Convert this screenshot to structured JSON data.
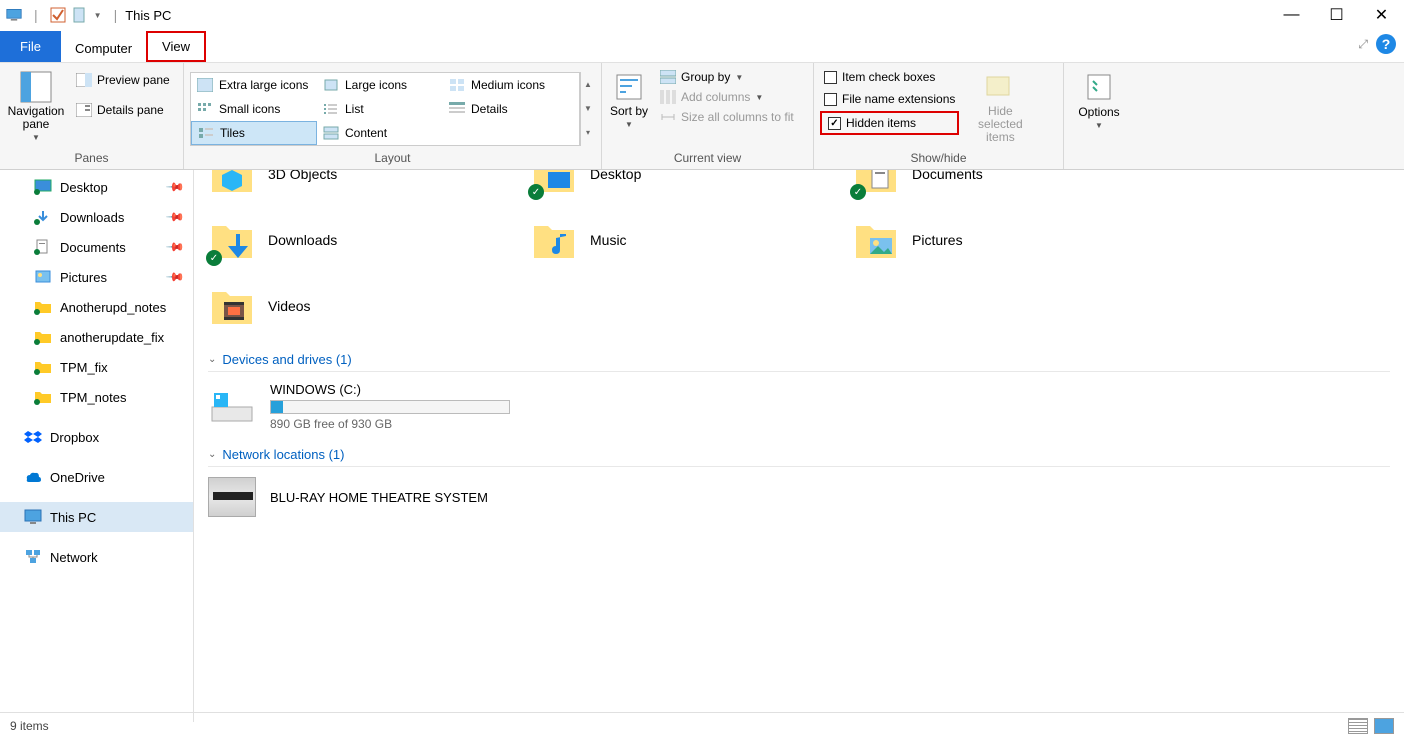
{
  "titlebar": {
    "title": "This PC"
  },
  "tabs": {
    "file": "File",
    "computer": "Computer",
    "view": "View"
  },
  "ribbon": {
    "panes": {
      "navigation": "Navigation pane",
      "preview": "Preview pane",
      "details_pane": "Details pane",
      "group_label": "Panes"
    },
    "layout": {
      "items": [
        "Extra large icons",
        "Large icons",
        "Medium icons",
        "Small icons",
        "List",
        "Details",
        "Tiles",
        "Content"
      ],
      "selected": "Tiles",
      "group_label": "Layout"
    },
    "current_view": {
      "sort_by": "Sort by",
      "group_by": "Group by",
      "add_columns": "Add columns",
      "size_all": "Size all columns to fit",
      "group_label": "Current view"
    },
    "show_hide": {
      "item_check_boxes": "Item check boxes",
      "file_name_ext": "File name extensions",
      "hidden_items": "Hidden items",
      "hide_selected": "Hide selected items",
      "group_label": "Show/hide"
    },
    "options": {
      "label": "Options"
    }
  },
  "sidebar": {
    "items": [
      {
        "label": "Desktop",
        "icon": "desktop",
        "pinned": true
      },
      {
        "label": "Downloads",
        "icon": "downloads",
        "pinned": true
      },
      {
        "label": "Documents",
        "icon": "documents",
        "pinned": true
      },
      {
        "label": "Pictures",
        "icon": "pictures",
        "pinned": true
      },
      {
        "label": "Anotherupd_notes",
        "icon": "folder"
      },
      {
        "label": "anotherupdate_fix",
        "icon": "folder"
      },
      {
        "label": "TPM_fix",
        "icon": "folder"
      },
      {
        "label": "TPM_notes",
        "icon": "folder"
      }
    ],
    "dropbox": "Dropbox",
    "onedrive": "OneDrive",
    "this_pc": "This PC",
    "network": "Network"
  },
  "content": {
    "folders": [
      {
        "label": "3D Objects",
        "badge": false,
        "icon": "3d"
      },
      {
        "label": "Desktop",
        "badge": true,
        "icon": "desktop-folder"
      },
      {
        "label": "Documents",
        "badge": true,
        "icon": "documents-folder"
      },
      {
        "label": "Downloads",
        "badge": true,
        "icon": "downloads-folder"
      },
      {
        "label": "Music",
        "badge": false,
        "icon": "music-folder"
      },
      {
        "label": "Pictures",
        "badge": false,
        "icon": "pictures-folder"
      },
      {
        "label": "Videos",
        "badge": false,
        "icon": "videos-folder"
      }
    ],
    "devices_header": "Devices and drives (1)",
    "drive": {
      "label": "WINDOWS (C:)",
      "free_text": "890 GB free of 930 GB",
      "fill_pct": 5
    },
    "network_header": "Network locations (1)",
    "bluray": "BLU-RAY HOME THEATRE SYSTEM"
  },
  "statusbar": {
    "item_count": "9 items"
  }
}
